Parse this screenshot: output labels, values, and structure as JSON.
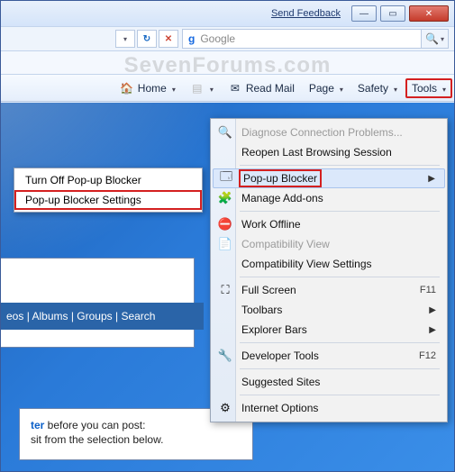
{
  "titlebar": {
    "feedback": "Send Feedback"
  },
  "search": {
    "engine_glyph": "g",
    "placeholder": "Google"
  },
  "watermark": "SevenForums.com",
  "cmdbar": {
    "home": "Home",
    "readmail": "Read Mail",
    "page": "Page",
    "safety": "Safety",
    "tools": "Tools"
  },
  "submenu": {
    "turn_off": "Turn Off Pop-up Blocker",
    "settings": "Pop-up Blocker Settings"
  },
  "tabstrip": {
    "text_parts": [
      "eos",
      "Albums",
      "Groups",
      "Search"
    ]
  },
  "msgbox": {
    "link_word": "ter",
    "line1_rest": " before you can post:",
    "line2": "sit from the selection below."
  },
  "toolsmenu": {
    "items": [
      {
        "key": "diagnose",
        "label": "Diagnose Connection Problems...",
        "disabled": true,
        "icon": "🔍"
      },
      {
        "key": "reopen",
        "label": "Reopen Last Browsing Session"
      },
      {
        "sep": true
      },
      {
        "key": "popup",
        "label": "Pop-up Blocker",
        "submenu": true,
        "highlight": true,
        "icon": "🗔"
      },
      {
        "key": "addons",
        "label": "Manage Add-ons",
        "icon": "🧩"
      },
      {
        "sep": true
      },
      {
        "key": "offline",
        "label": "Work Offline",
        "icon": "⛔"
      },
      {
        "key": "compatview",
        "label": "Compatibility View",
        "disabled": true,
        "icon": "📄"
      },
      {
        "key": "compatset",
        "label": "Compatibility View Settings"
      },
      {
        "sep": true
      },
      {
        "key": "fullscreen",
        "label": "Full Screen",
        "shortcut": "F11",
        "icon": "⛶"
      },
      {
        "key": "toolbars",
        "label": "Toolbars",
        "submenu": true
      },
      {
        "key": "explorerbars",
        "label": "Explorer Bars",
        "submenu": true
      },
      {
        "sep": true
      },
      {
        "key": "devtools",
        "label": "Developer Tools",
        "shortcut": "F12",
        "icon": "🔧"
      },
      {
        "sep": true
      },
      {
        "key": "suggested",
        "label": "Suggested Sites"
      },
      {
        "sep": true
      },
      {
        "key": "inetopt",
        "label": "Internet Options",
        "icon": "⚙"
      }
    ]
  }
}
